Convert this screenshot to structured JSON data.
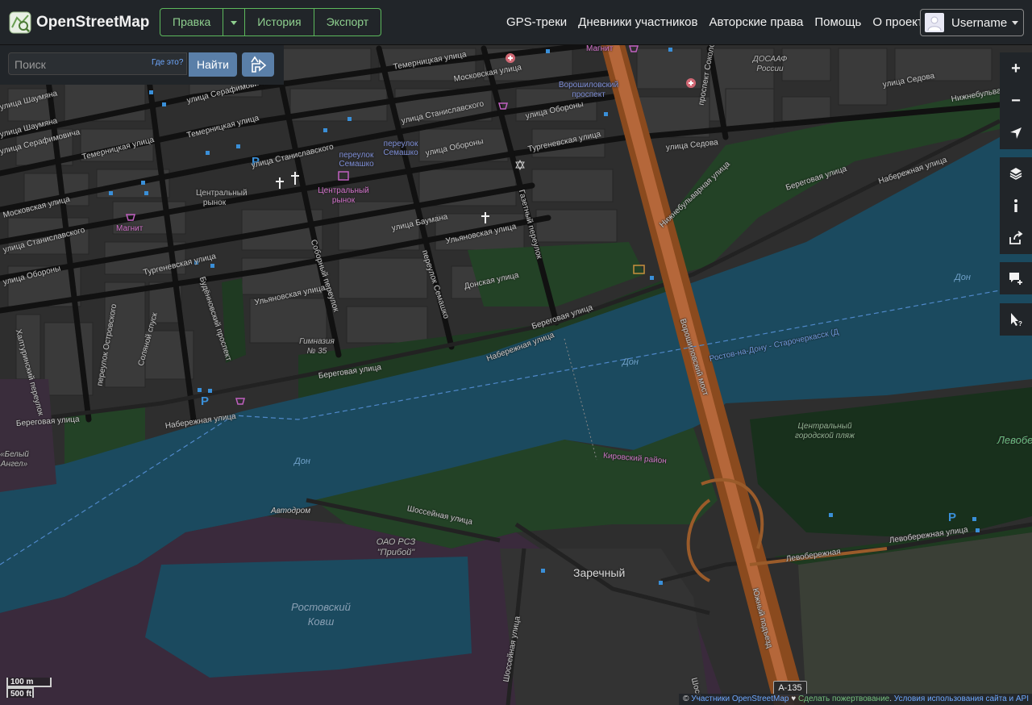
{
  "header": {
    "brand": "OpenStreetMap",
    "edit": "Правка",
    "history": "История",
    "export": "Экспорт",
    "nav": [
      "GPS-треки",
      "Дневники участников",
      "Авторские права",
      "Помощь",
      "О проекте"
    ],
    "username": "Username"
  },
  "search": {
    "placeholder": "Поиск",
    "where": "Где это?",
    "go": "Найти"
  },
  "controls": {
    "zoom_in": "+",
    "zoom_out": "−"
  },
  "scale": {
    "metric": "100 m",
    "imperial": "500 ft"
  },
  "attribution": {
    "prefix": "© ",
    "contributors": "Участники OpenStreetMap",
    "heart": " ♥ ",
    "donate": "Сделать пожертвование",
    "sep": ". ",
    "terms": "Условия использования сайта и API"
  },
  "shield": "A-135",
  "colors": {
    "water": "#1b4a5f",
    "land": "#2f2f2f",
    "park": "#223d24",
    "bridge": "#8a4a1e",
    "header_bg": "#212529",
    "accent_green": "#5cb85c",
    "accent_blue": "#5a7fa8"
  },
  "map_labels": {
    "temernitskaya1": "Темерницкая улица",
    "moskovskaya1": "Московская улица",
    "voroshilovsky_top": "Ворошиловский проспект",
    "magnit_top": "Магнит",
    "prospekt_sokolova": "проспект Соколова",
    "dosaaf": "ДОСААФ России",
    "sedova": "улица Седова",
    "nizhnebulvarnaya": "Нижнебульварный",
    "shaumyana": "улица Шаумяна",
    "serafimovicha": "улица Серафимовича",
    "temernitskaya2": "Темерницкая улица",
    "stanislavskogo_top": "улица Станиславского",
    "oborony_top": "улица Обороны",
    "pereulok_semashko": "переулок Семашко",
    "pereulok_semashko2": "переулок Семашко",
    "turgenevskaya_top": "Тургеневская улица",
    "sedova2": "улица Седова",
    "oborony_mid": "улица Обороны",
    "stanislavskogo_mid": "улица Станиславского",
    "serafimovicha2": "улица Серафимовича",
    "temernitskaya3": "Темерницкая улица",
    "shaumyana2": "улица Шаумяна",
    "tsentralny_rynok_gray": "Центральный рынок",
    "tsentralny_rynok_pink": "Центральный рынок",
    "moskovskaya2": "Московская улица",
    "stanislavskogo_left": "улица Станиславского",
    "magnit_left": "Магнит",
    "baumana": "улица Баумана",
    "ulyanovskaya_top": "Ульяновская улица",
    "gazetny": "Газетный переулок",
    "oborony_left": "улица Обороны",
    "turgenevskaya_left": "Тургеневская улица",
    "budennovsky": "Будённовский проспект",
    "sobornyi": "Соборный переулок",
    "pereulok_semashko3": "переулок Семашко",
    "donskaya": "Донская улица",
    "ulyanovskaya2": "Ульяновская улица",
    "khalturinsky": "Халтуринский переулок",
    "ostrovskogo": "переулок Островского",
    "solyanoy": "Соляной спуск",
    "gimnaziya": "Гимназия № 35",
    "beregovaya1": "Береговая улица",
    "naberezhnaya1": "Набережная улица",
    "beregovaya2": "Береговая улица",
    "beregovaya_right": "Береговая улица",
    "nizhnebulvarnaya2": "Нижнебульварная улица",
    "naberezhnaya2": "Набережная улица",
    "beregovaya_left": "Береговая улица",
    "naberezhnaya_left": "Набережная улица",
    "bely_angel": "«Белый Ангел»",
    "don1": "Дон",
    "don2": "Дон",
    "don3": "Дон",
    "rostov_line": "Ростов-на-Дону - Старочеркасск (Д",
    "voroshilovsky_bridge": "Ворошиловский мост",
    "kirovsky": "Кировский район",
    "tsentralny_plyazh": "Центральный городской пляж",
    "levoberezhny": "Левобе",
    "avtodrom": "Автодром",
    "shosseynaya1": "Шоссейная улица",
    "oao_rsz": "ОАО РСЗ \"Прибой\"",
    "zarechny": "Заречный",
    "levoberezhnaya1": "Левобережная",
    "levoberezhnaya2": "Левобережная улица",
    "yuzhny": "Южный подъезд",
    "rostovsky_kovsh": "Ростовский Ковш",
    "shosseynaya2": "Шоссейная улица",
    "shosse_right": "Шоссе"
  }
}
